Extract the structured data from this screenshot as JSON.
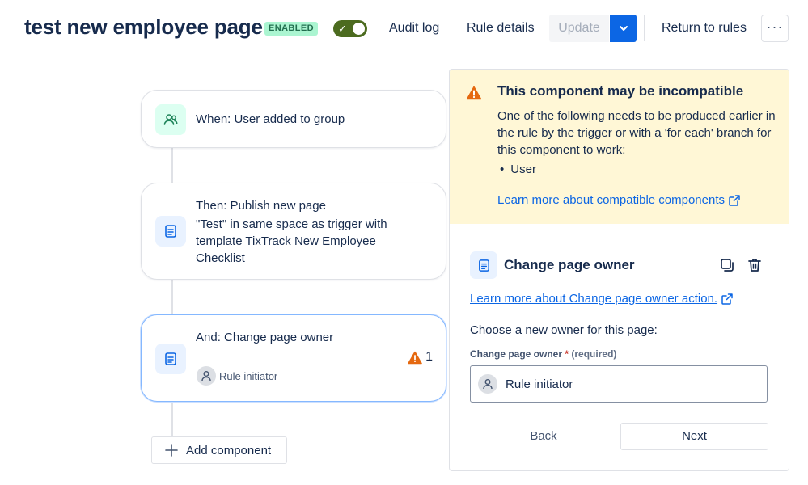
{
  "header": {
    "title": "test new employee page",
    "status_badge": "ENABLED",
    "rule_enabled": true,
    "audit_log": "Audit log",
    "rule_details": "Rule details",
    "update": "Update",
    "return_to_rules": "Return to rules",
    "more_label": "···"
  },
  "flow": {
    "trigger": {
      "label": "When: User added to group",
      "icon": "users-icon"
    },
    "action1": {
      "label": "Then: Publish new page",
      "description": "\"Test\" in same space as trigger with template TixTrack New Employee Checklist",
      "icon": "page-icon"
    },
    "action2": {
      "label": "And: Change page owner",
      "warning_count": "1",
      "owner": "Rule initiator",
      "icon": "page-icon"
    },
    "add_component": "Add component"
  },
  "panel": {
    "warning": {
      "title": "This component may be incompatible",
      "body": "One of the following needs to be produced earlier in the rule by the trigger or with a 'for each' branch for this component to work:",
      "items": [
        "User"
      ],
      "link": "Learn more about compatible components"
    },
    "component": {
      "title": "Change page owner",
      "link": "Learn more about Change page owner action.",
      "prompt": "Choose a new owner for this page:",
      "field_label": "Change page owner",
      "required_mark": "*",
      "required_text": "(required)",
      "field_value": "Rule initiator"
    },
    "back": "Back",
    "next": "Next"
  },
  "colors": {
    "primary": "#0c66e4",
    "toggle_on": "#4c6b1f",
    "badge_bg": "#abf5d1",
    "warning_bg": "#fff7d6",
    "warning_icon": "#e56910"
  }
}
